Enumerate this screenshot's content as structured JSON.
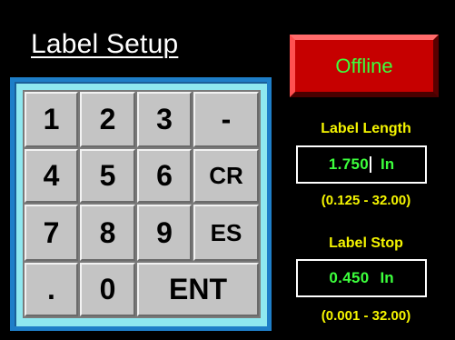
{
  "screen": {
    "title": "Label Setup",
    "status_button": "Offline"
  },
  "keypad": {
    "keys": [
      [
        "1",
        "2",
        "3",
        "-"
      ],
      [
        "4",
        "5",
        "6",
        "CR"
      ],
      [
        "7",
        "8",
        "9",
        "ES"
      ],
      [
        ".",
        "0",
        "ENT"
      ]
    ]
  },
  "label_length": {
    "label": "Label Length",
    "value": "1.750",
    "unit": "In",
    "range": "(0.125 - 32.00)"
  },
  "label_stop": {
    "label": "Label Stop",
    "value": "0.450",
    "unit": "In",
    "range": "(0.001 - 32.00)"
  },
  "colors": {
    "background": "#000000",
    "status_red": "#c60000",
    "value_green": "#3cff3c",
    "label_yellow": "#f5f500",
    "keypad_frame": "#8fe8f0"
  }
}
